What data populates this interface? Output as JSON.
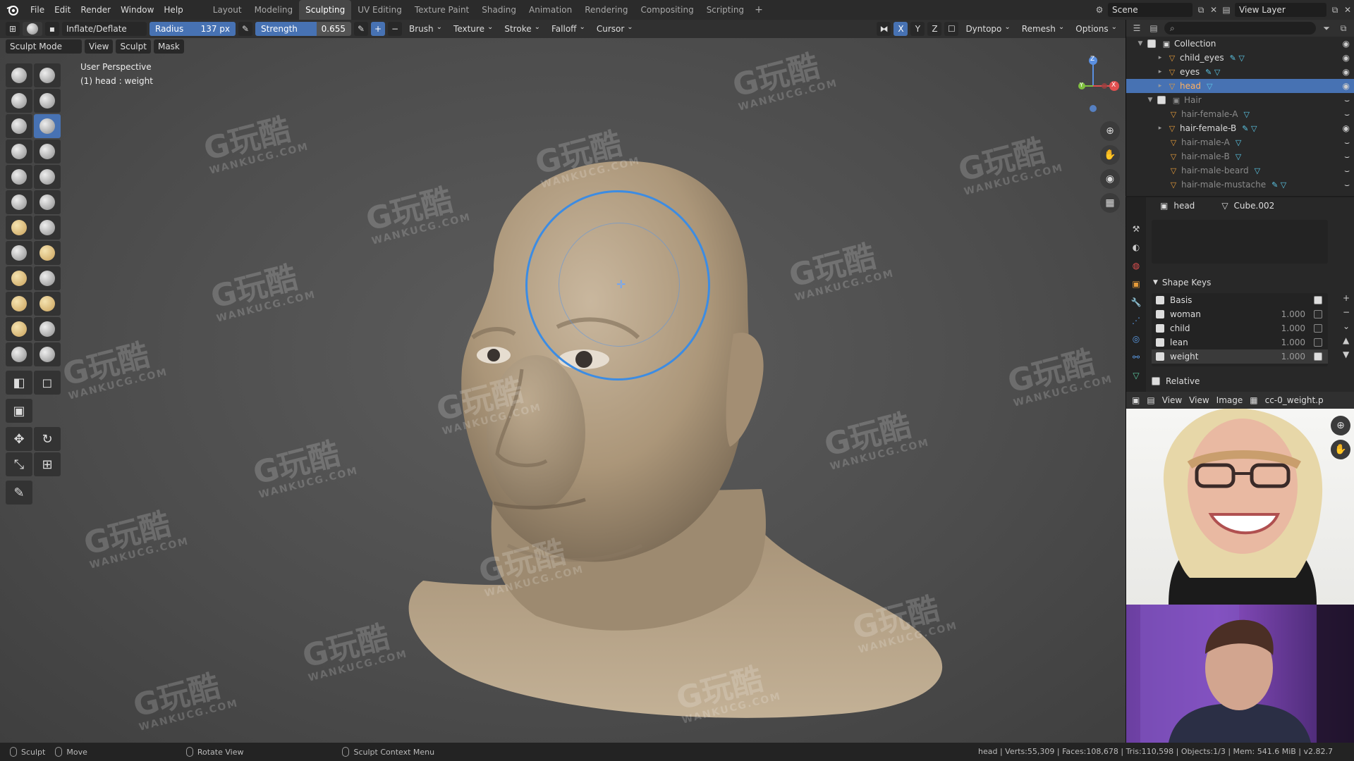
{
  "menu": {
    "items": [
      "File",
      "Edit",
      "Render",
      "Window",
      "Help"
    ]
  },
  "workspaces": {
    "tabs": [
      "Layout",
      "Modeling",
      "Sculpting",
      "UV Editing",
      "Texture Paint",
      "Shading",
      "Animation",
      "Rendering",
      "Compositing",
      "Scripting"
    ],
    "active": "Sculpting",
    "add": "+"
  },
  "scene": {
    "name": "Scene",
    "view_layer": "View Layer"
  },
  "header": {
    "brush_name": "Inflate/Deflate",
    "radius_label": "Radius",
    "radius_value": "137 px",
    "strength_label": "Strength",
    "strength_value": "0.655",
    "plus": "+",
    "minus": "−",
    "brush": "Brush",
    "texture": "Texture",
    "stroke": "Stroke",
    "falloff": "Falloff",
    "cursor": "Cursor",
    "x": "X",
    "y": "Y",
    "z": "Z",
    "dyntopo": "Dyntopo",
    "remesh": "Remesh",
    "options": "Options"
  },
  "viewport_bar": {
    "mode": "Sculpt Mode",
    "view": "View",
    "sculpt": "Sculpt",
    "mask": "Mask"
  },
  "viewport": {
    "perspective": "User Perspective",
    "object": "(1) head : weight"
  },
  "gizmo": {
    "x": "X",
    "y": "Y",
    "z": "Z"
  },
  "outliner": {
    "items": [
      {
        "label": "Collection"
      },
      {
        "label": "child_eyes"
      },
      {
        "label": "eyes"
      },
      {
        "label": "head"
      },
      {
        "label": "Hair"
      },
      {
        "label": "hair-female-A"
      },
      {
        "label": "hair-female-B"
      },
      {
        "label": "hair-male-A"
      },
      {
        "label": "hair-male-B"
      },
      {
        "label": "hair-male-beard"
      },
      {
        "label": "hair-male-mustache"
      }
    ]
  },
  "properties": {
    "object": "head",
    "mesh": "Cube.002",
    "shape_keys_title": "Shape Keys",
    "shape_keys": [
      {
        "name": "Basis",
        "value": ""
      },
      {
        "name": "woman",
        "value": "1.000"
      },
      {
        "name": "child",
        "value": "1.000"
      },
      {
        "name": "lean",
        "value": "1.000"
      },
      {
        "name": "weight",
        "value": "1.000"
      }
    ],
    "relative": "Relative"
  },
  "image_editor": {
    "view": "View",
    "view2": "View",
    "image": "Image",
    "filename": "cc-0_weight.p"
  },
  "status": {
    "sculpt": "Sculpt",
    "move": "Move",
    "rotate": "Rotate View",
    "context": "Sculpt Context Menu",
    "stats": "head | Verts:55,309 | Faces:108,678 | Tris:110,598 | Objects:1/3 | Mem: 541.6 MiB | v2.82.7"
  },
  "watermark": {
    "text": "G玩酷",
    "url": "WANKUCG.COM"
  },
  "colors": {
    "accent": "#4772b3",
    "brush_circle": "#3c8ce3",
    "skin": "#b8a48a"
  }
}
